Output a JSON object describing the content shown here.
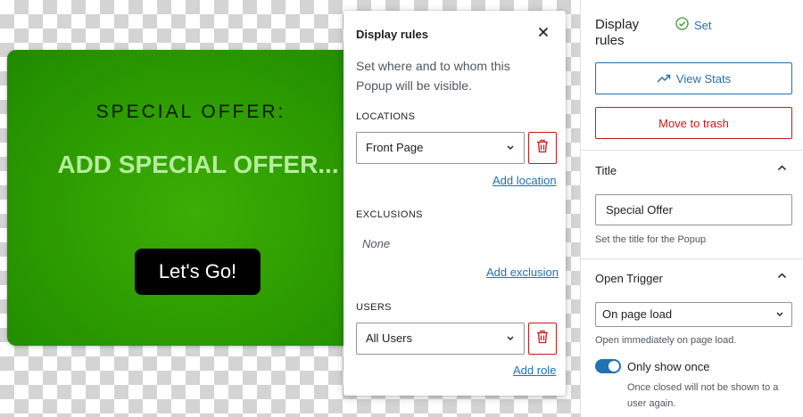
{
  "popup": {
    "eyebrow": "SPECIAL OFFER:",
    "title": "ADD SPECIAL OFFER...",
    "cta_label": "Let's Go!",
    "background_color": "#2f9e00",
    "title_color": "#b6ec9c"
  },
  "display_rules": {
    "title": "Display rules",
    "close_icon": "close-icon",
    "description": "Set where and to whom this Popup will be visible.",
    "locations": {
      "label": "LOCATIONS",
      "selected": "Front Page",
      "add_link": "Add location"
    },
    "exclusions": {
      "label": "EXCLUSIONS",
      "empty_text": "None",
      "add_link": "Add exclusion"
    },
    "users": {
      "label": "USERS",
      "selected": "All Users",
      "add_link": "Add role"
    }
  },
  "sidebar": {
    "heading": "Display rules",
    "status": "Set",
    "status_icon": "check-circle-icon",
    "view_stats_label": "View Stats",
    "move_to_trash_label": "Move to trash",
    "title_panel": {
      "label": "Title",
      "value": "Special Offer",
      "help": "Set the title for the Popup"
    },
    "trigger_panel": {
      "label": "Open Trigger",
      "selected": "On page load",
      "help": "Open immediately on page load.",
      "only_once_label": "Only show once",
      "only_once_enabled": true,
      "only_once_help": "Once closed will not be shown to a user again."
    }
  },
  "colors": {
    "accent": "#2271b1",
    "danger": "#cc1818"
  }
}
